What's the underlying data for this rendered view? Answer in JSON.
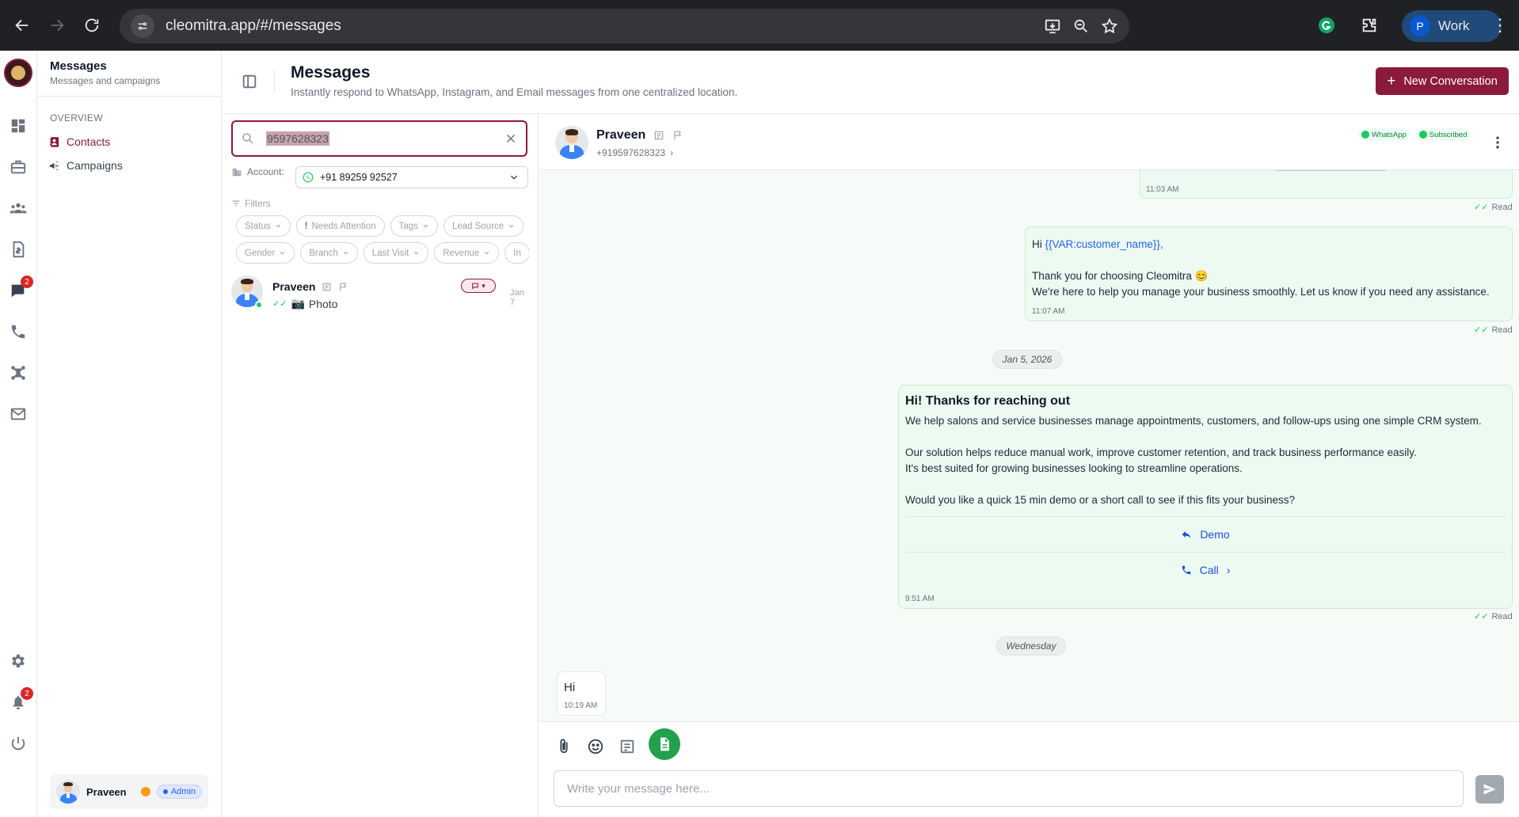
{
  "browser": {
    "url": "cleomitra.app/#/messages",
    "profile_initial": "P",
    "profile_label": "Work"
  },
  "nav": {
    "title": "Messages",
    "subtitle": "Messages and campaigns",
    "section": "OVERVIEW",
    "items": [
      {
        "label": "Contacts",
        "icon": "contacts-icon",
        "active": true
      },
      {
        "label": "Campaigns",
        "icon": "megaphone-icon",
        "active": false
      }
    ],
    "user": {
      "name": "Praveen",
      "role": "Admin"
    }
  },
  "rail": {
    "messages_badge": "2",
    "notifications_badge": "2"
  },
  "header": {
    "title": "Messages",
    "subtitle": "Instantly respond to WhatsApp, Instagram, and Email messages from one centralized location.",
    "new_button": "New Conversation"
  },
  "list": {
    "search_value": "9597628323",
    "account_label": "Account:",
    "account_value": "+91 89259 92527",
    "filters_label": "Filters",
    "filter_chips_row1": [
      "Status",
      "Needs Attention",
      "Tags",
      "Lead Source"
    ],
    "filter_chips_row2": [
      "Gender",
      "Branch",
      "Last Visit",
      "Revenue",
      "In"
    ],
    "conversation": {
      "name": "Praveen",
      "preview": "Photo",
      "date": "Jan 7"
    }
  },
  "chat": {
    "contact_name": "Praveen",
    "contact_phone": "+919597628323",
    "badge_channel": "WhatsApp",
    "badge_status": "Subscribed",
    "msg1": {
      "time": "11:03 AM",
      "status": "Read"
    },
    "msg2": {
      "greeting": "Hi ",
      "variable": "{{VAR:customer_name}},",
      "line1": "Thank you for choosing Cleomitra 😊",
      "line2": "We're here to help you manage your business smoothly. Let us know if you need any assistance.",
      "time": "11:07 AM",
      "status": "Read"
    },
    "date_sep1": "Jan 5, 2026",
    "msg3": {
      "title": "Hi! Thanks for reaching out",
      "line1": "We help salons and service businesses manage appointments, customers, and follow-ups using one simple CRM system.",
      "line2": "Our solution helps reduce manual work, improve customer retention, and track business performance easily.",
      "line3": "It's best suited for growing businesses looking to streamline operations.",
      "line4": "Would you like a quick 15 min demo or a short call to see if this fits your business?",
      "button1": "Demo",
      "button2": "Call",
      "time": "9:51 AM",
      "status": "Read"
    },
    "date_sep2": "Wednesday",
    "msg4": {
      "text": "Hi",
      "time": "10:19 AM"
    },
    "composer_placeholder": "Write your message here..."
  },
  "colors": {
    "brand": "#8b1a3c",
    "whatsapp_green": "#22c55e",
    "bubble_out": "#ecfaf1",
    "link_blue": "#2563eb"
  }
}
